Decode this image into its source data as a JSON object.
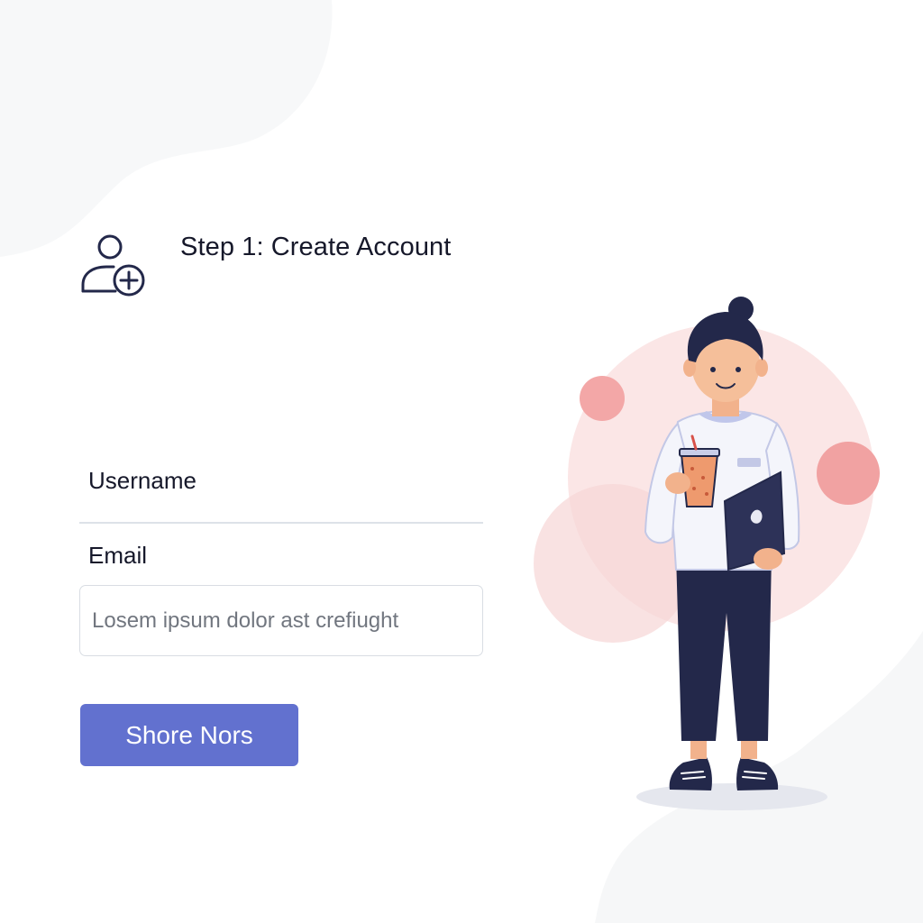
{
  "header": {
    "title": "Step 1: Create Account",
    "icon": "add-user-icon"
  },
  "form": {
    "username_label": "Username",
    "email_label": "Email",
    "email_placeholder": "Losem ipsum dolor ast crefiught",
    "submit_label": "Shore Nors"
  },
  "illustration": {
    "subject": "person-holding-drink-and-laptop"
  },
  "colors": {
    "accent": "#6271cf",
    "text": "#16182a",
    "placeholder": "#71767f",
    "input_border": "#d9dde3",
    "pink": "#f6d4d4",
    "navy": "#23284a"
  }
}
